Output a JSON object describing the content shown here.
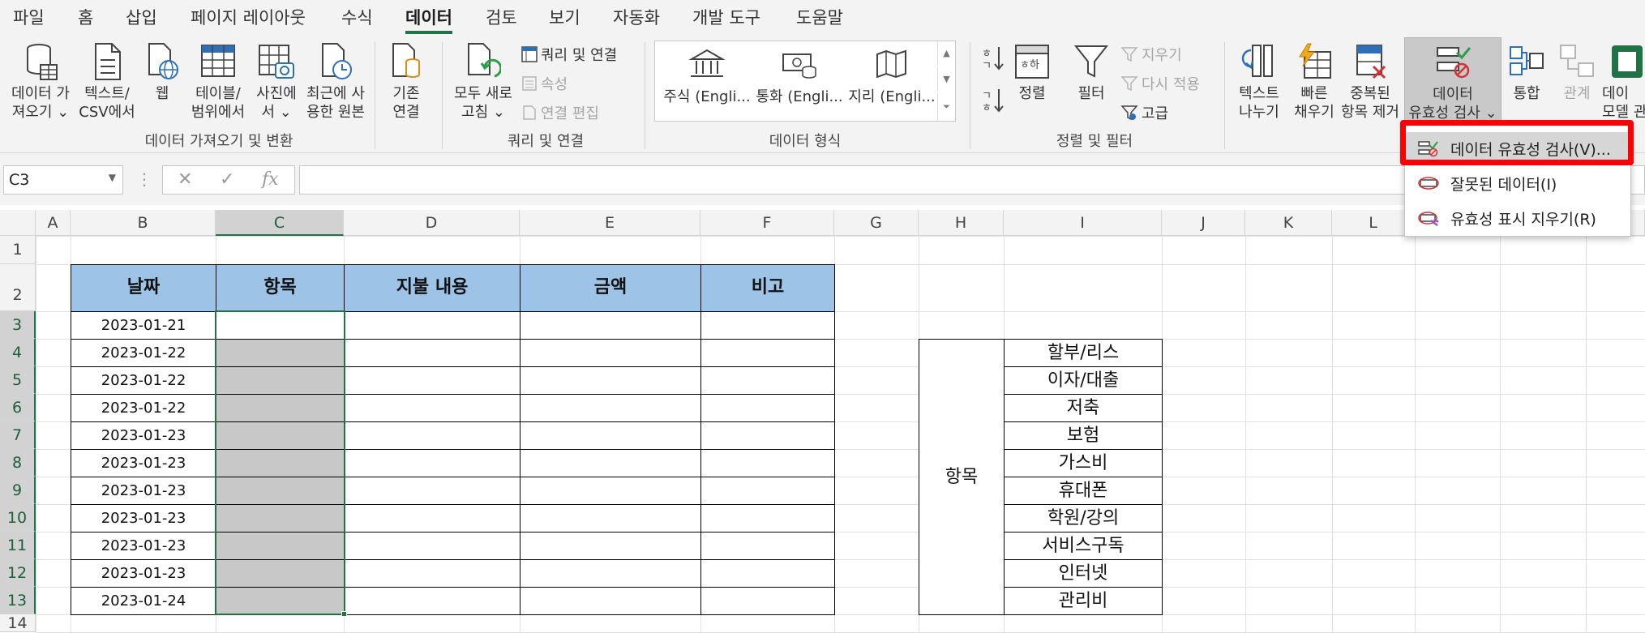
{
  "tabs": [
    "파일",
    "홈",
    "삽입",
    "페이지 레이아웃",
    "수식",
    "데이터",
    "검토",
    "보기",
    "자동화",
    "개발 도구",
    "도움말"
  ],
  "active_tab": "데이터",
  "ribbon": {
    "get_data": [
      "데이터 가",
      "져오기 ⌄"
    ],
    "from_text": [
      "텍스트/",
      "CSV에서"
    ],
    "web": "웹",
    "from_table": [
      "테이블/",
      "범위에서"
    ],
    "from_picture": [
      "사진에",
      "서 ⌄"
    ],
    "recent_sources": [
      "최근에 사",
      "용한 원본"
    ],
    "existing_conn": [
      "기존",
      "연결"
    ],
    "group1": "데이터 가져오기 및 변환",
    "refresh_all": [
      "모두 새로",
      "고침 ⌄"
    ],
    "queries_conn": "쿼리 및 연결",
    "properties": "속성",
    "edit_links": "연결 편집",
    "group2": "쿼리 및 연결",
    "stocks": "주식 (Engli...",
    "currencies": "통화 (Engli...",
    "geography": "지리 (Engli...",
    "group3": "데이터 형식",
    "sort": "정렬",
    "filter": "필터",
    "clear": "지우기",
    "reapply": "다시 적용",
    "advanced": "고급",
    "group4": "정렬 및 필터",
    "text_to_cols": [
      "텍스트",
      "나누기"
    ],
    "flash_fill": [
      "빠른",
      "채우기"
    ],
    "remove_dup": [
      "중복된",
      "항목 제거"
    ],
    "data_validation": [
      "데이터",
      "유효성 검사 ⌄"
    ],
    "consolidate": "통합",
    "relationships": "관계",
    "data_model": [
      "데이",
      "모델 관"
    ]
  },
  "namebox": "C3",
  "columns": [
    "A",
    "B",
    "C",
    "D",
    "E",
    "F",
    "G",
    "H",
    "I",
    "J",
    "K",
    "L"
  ],
  "rows": [
    "1",
    "2",
    "3",
    "4",
    "5",
    "6",
    "7",
    "8",
    "9",
    "10",
    "11",
    "12",
    "13",
    "14"
  ],
  "table": {
    "headers": [
      "날짜",
      "항목",
      "지불 내용",
      "금액",
      "비고"
    ],
    "dates": [
      "2023-01-21",
      "2023-01-22",
      "2023-01-22",
      "2023-01-22",
      "2023-01-23",
      "2023-01-23",
      "2023-01-23",
      "2023-01-23",
      "2023-01-23",
      "2023-01-23",
      "2023-01-24"
    ]
  },
  "category": {
    "label": "항목",
    "items": [
      "할부/리스",
      "이자/대출",
      "저축",
      "보험",
      "가스비",
      "휴대폰",
      "학원/강의",
      "서비스구독",
      "인터넷",
      "관리비"
    ]
  },
  "menu": [
    "데이터 유효성 검사(V)...",
    "잘못된 데이터(I)",
    "유효성 표시 지우기(R)"
  ],
  "colors": {
    "accent": "#217346",
    "header_fill": "#9dc3e6",
    "highlight": "#ff0000"
  }
}
